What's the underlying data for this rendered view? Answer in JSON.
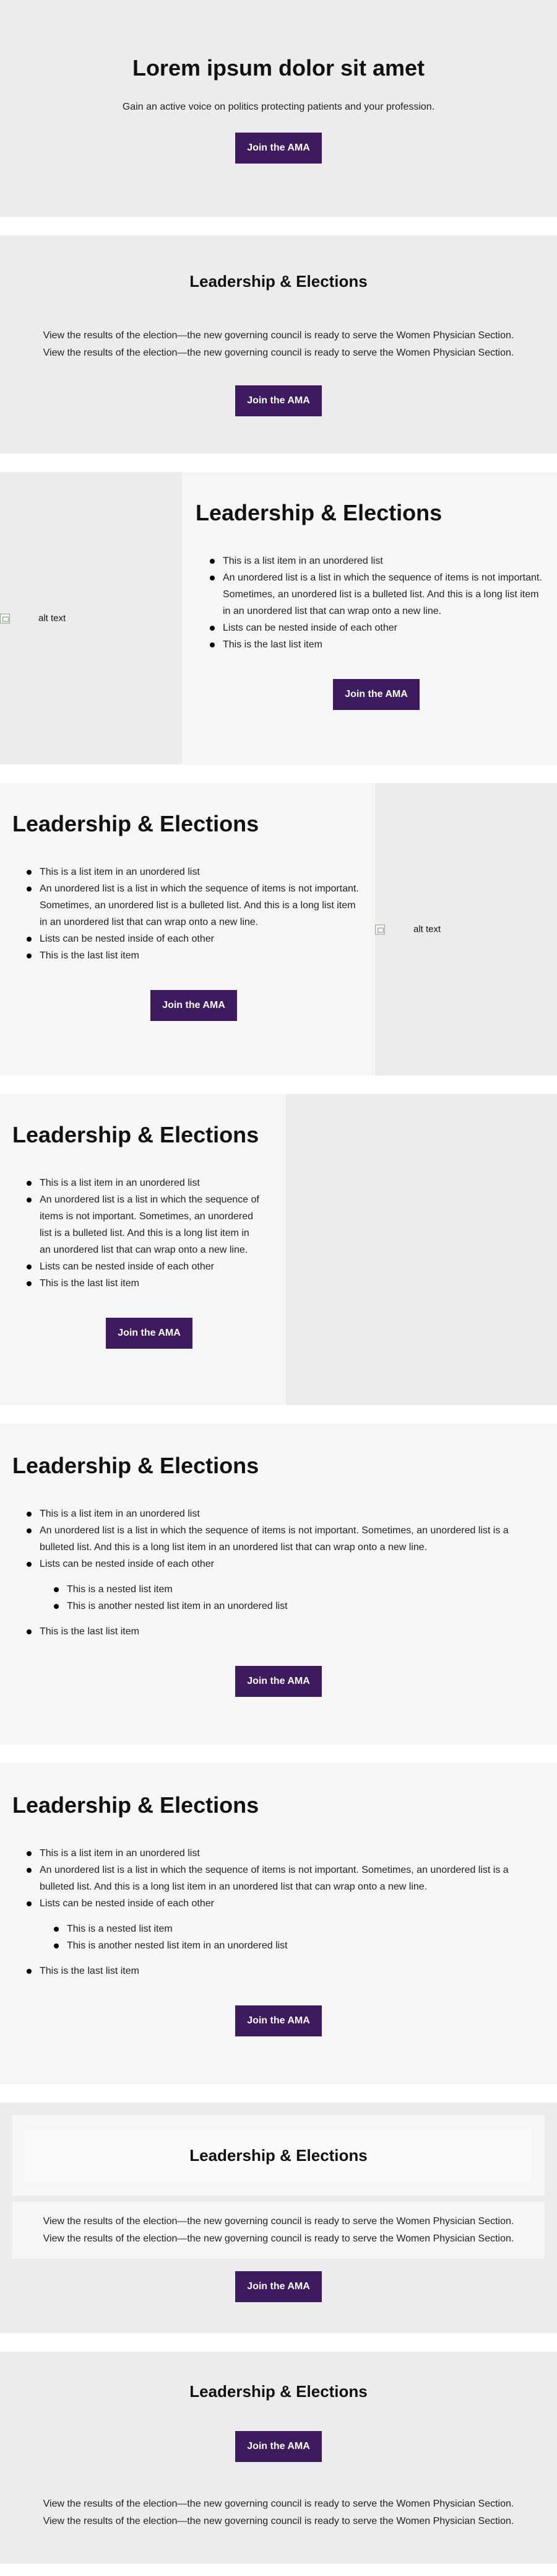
{
  "hero": {
    "title": "Lorem ipsum dolor sit amet",
    "subtitle": "Gain an active voice on politics protecting patients and your profession.",
    "button": "Join the AMA"
  },
  "section2": {
    "title": "Leadership & Elections",
    "desc_line1": "View the results of the election—the new governing council is ready to serve the Women Physician Section.",
    "desc_line2": "View the results of the election—the new governing council is ready to serve the Women Physician Section.",
    "button": "Join the AMA"
  },
  "section3": {
    "image_alt": "alt text",
    "title": "Leadership & Elections",
    "items": [
      "This is a list item in an unordered list",
      "An unordered list is a list in which the sequence of items is not important. Sometimes, an unordered list is a bulleted list. And this is a long list item in an unordered list that can wrap onto a new line.",
      "Lists can be nested inside of each other",
      "This is the last list item"
    ],
    "button": "Join the AMA"
  },
  "section4": {
    "image_alt": "alt text",
    "title": "Leadership & Elections",
    "items": [
      "This is a list item in an unordered list",
      "An unordered list is a list in which the sequence of items is not important. Sometimes, an unordered list is a bulleted list. And this is a long list item in an unordered list that can wrap onto a new line.",
      "Lists can be nested inside of each other",
      "This is the last list item"
    ],
    "button": "Join the AMA"
  },
  "section5": {
    "title": "Leadership & Elections",
    "items": [
      "This is a list item in an unordered list",
      "An unordered list is a list in which the sequence of items is not important. Sometimes, an unordered list is a bulleted list. And this is a long list item in an unordered list that can wrap onto a new line.",
      "Lists can be nested inside of each other",
      "This is the last list item"
    ],
    "button": "Join the AMA"
  },
  "section6": {
    "title": "Leadership & Elections",
    "items": [
      "This is a list item in an unordered list",
      "An unordered list is a list in which the sequence of items is not important. Sometimes, an unordered list is a bulleted list. And this is a long list item in an unordered list that can wrap onto a new line.",
      "Lists can be nested inside of each other",
      "This is the last list item"
    ],
    "nested": [
      "This is a nested list item",
      "This is another nested list item in an unordered list"
    ],
    "button": "Join the AMA"
  },
  "section7": {
    "title": "Leadership & Elections",
    "items": [
      "This is a list item in an unordered list",
      "An unordered list is a list in which the sequence of items is not important. Sometimes, an unordered list is a bulleted list. And this is a long list item in an unordered list that can wrap onto a new line.",
      "Lists can be nested inside of each other",
      "This is the last list item"
    ],
    "nested": [
      "This is a nested list item",
      "This is another nested list item in an unordered list"
    ],
    "button": "Join the AMA"
  },
  "section8": {
    "title": "Leadership & Elections",
    "desc_line1": "View the results of the election—the new governing council is ready to serve the Women Physician Section.",
    "desc_line2": "View the results of the election—the new governing council is ready to serve the Women Physician Section.",
    "button": "Join the AMA"
  },
  "section9": {
    "title": "Leadership & Elections",
    "button": "Join the AMA",
    "desc_line1": "View the results of the election—the new governing council is ready to serve the Women Physician Section.",
    "desc_line2": "View the results of the election—the new governing council is ready to serve the Women Physician Section."
  },
  "colors": {
    "button_bg": "#3d1b5e",
    "section_grey": "#ececec",
    "section_light": "#f6f6f6"
  }
}
